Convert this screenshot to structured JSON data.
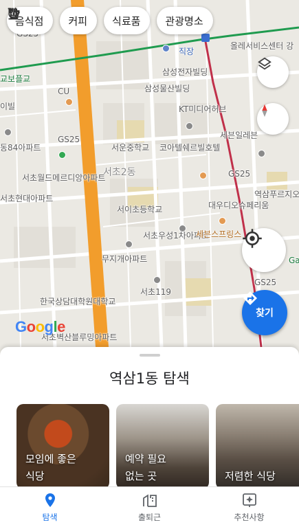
{
  "chips": [
    {
      "label": "음식점",
      "icon": "fork-knife-icon"
    },
    {
      "label": "커피",
      "icon": "coffee-cup-icon"
    },
    {
      "label": "식료품",
      "icon": "shopping-cart-icon"
    },
    {
      "label": "관광명소",
      "icon": "tourist-attraction-icon"
    }
  ],
  "map_labels": {
    "l1": "직장",
    "l2": "삼성전자빌딩",
    "l3": "삼성물산빌딩",
    "l4": "KT미디어허브",
    "l5": "세븐일레븐",
    "l6": "서운중학교",
    "l7": "코아텔쉐르빌호텔",
    "l8": "서초2동",
    "l9": "GS25",
    "l10": "GS25",
    "l11": "역삼푸르지오",
    "l12": "서이초등학교",
    "l13": "대우디오슈페리움",
    "l14": "서초우성1차아파트",
    "l15": "세븐스프링스",
    "l16": "무지개아파트",
    "l17": "서초119",
    "l18": "한국상담대학원대학교",
    "l19": "서초벽산블루밍아파트",
    "l20": "CU",
    "l21": "GS25",
    "l22": "서초월드메르디앙아파트",
    "l23": "서초현대아파트",
    "l24": "동84아파트",
    "l25": "이빌",
    "l26": "교보플교",
    "l27": "GS25",
    "l28": "올레서비스센터 강",
    "l29": "Gang"
  },
  "google_logo": "Google",
  "go_button": {
    "label": "찾기"
  },
  "explore": {
    "title": "역삼1동 탐색",
    "cards": [
      {
        "line1": "모임에 좋은",
        "line2": "식당"
      },
      {
        "line1": "예약 필요",
        "line2": "없는 곳"
      },
      {
        "line1": "저렴한 식당",
        "line2": ""
      }
    ]
  },
  "nav": [
    {
      "label": "탐색",
      "icon": "location-pin-icon",
      "active": true
    },
    {
      "label": "출퇴근",
      "icon": "commute-building-icon",
      "active": false
    },
    {
      "label": "추천사항",
      "icon": "recommendations-icon",
      "active": false
    }
  ],
  "colors": {
    "accent": "#1a73e8",
    "main_road": "#f29d2c",
    "subway_green": "#1f9b4f",
    "subway_red": "#c0304a"
  }
}
